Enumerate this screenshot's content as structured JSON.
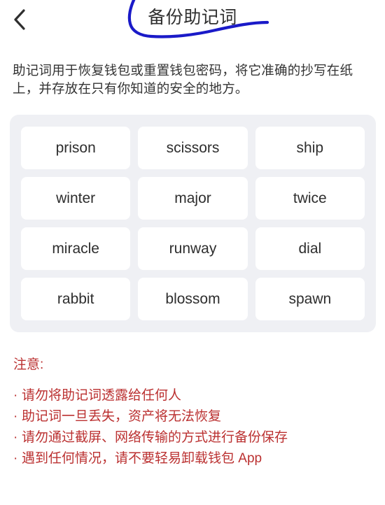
{
  "header": {
    "back_icon": "chevron-left-icon",
    "title": "备份助记词",
    "annotation": {
      "name": "handdrawn-circle-annotation",
      "color": "#1a1ac8"
    }
  },
  "description": {
    "text": "助记词用于恢复钱包或重置钱包密码，将它准确的抄写在纸上，并存放在只有你知道的安全的地方。"
  },
  "mnemonic": {
    "panel_bg": "#eff0f4",
    "card_bg": "#ffffff",
    "words": [
      "prison",
      "scissors",
      "ship",
      "winter",
      "major",
      "twice",
      "miracle",
      "runway",
      "dial",
      "rabbit",
      "blossom",
      "spawn"
    ]
  },
  "warning": {
    "color": "#bb3131",
    "title": "注意:",
    "bullet": "·",
    "items": [
      "请勿将助记词透露给任何人",
      "助记词一旦丢失，资产将无法恢复",
      "请勿通过截屏、网络传输的方式进行备份保存",
      "遇到任何情况，请不要轻易卸载钱包 App"
    ]
  }
}
